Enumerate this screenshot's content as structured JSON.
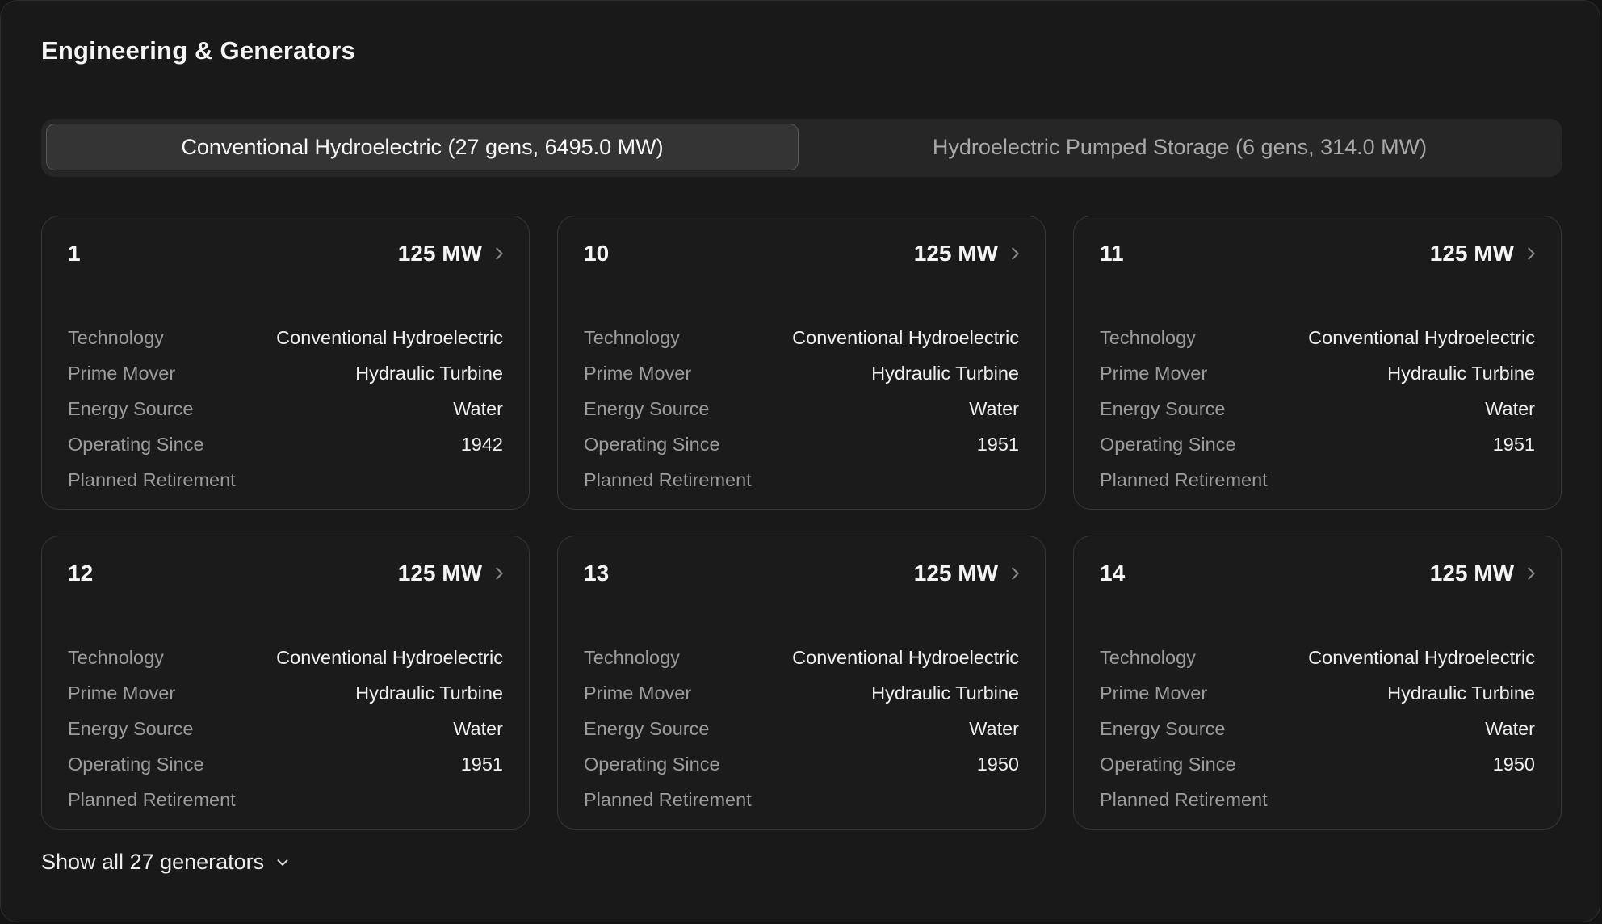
{
  "section": {
    "title": "Engineering & Generators"
  },
  "tabs": [
    {
      "label": "Conventional Hydroelectric (27 gens, 6495.0 MW)",
      "active": true
    },
    {
      "label": "Hydroelectric Pumped Storage (6 gens, 314.0 MW)",
      "active": false
    }
  ],
  "field_labels": {
    "technology": "Technology",
    "prime_mover": "Prime Mover",
    "energy_source": "Energy Source",
    "operating_since": "Operating Since",
    "planned_retirement": "Planned Retirement"
  },
  "generators": [
    {
      "id": "1",
      "capacity": "125 MW",
      "technology": "Conventional Hydroelectric",
      "prime_mover": "Hydraulic Turbine",
      "energy_source": "Water",
      "operating_since": "1942",
      "planned_retirement": ""
    },
    {
      "id": "10",
      "capacity": "125 MW",
      "technology": "Conventional Hydroelectric",
      "prime_mover": "Hydraulic Turbine",
      "energy_source": "Water",
      "operating_since": "1951",
      "planned_retirement": ""
    },
    {
      "id": "11",
      "capacity": "125 MW",
      "technology": "Conventional Hydroelectric",
      "prime_mover": "Hydraulic Turbine",
      "energy_source": "Water",
      "operating_since": "1951",
      "planned_retirement": ""
    },
    {
      "id": "12",
      "capacity": "125 MW",
      "technology": "Conventional Hydroelectric",
      "prime_mover": "Hydraulic Turbine",
      "energy_source": "Water",
      "operating_since": "1951",
      "planned_retirement": ""
    },
    {
      "id": "13",
      "capacity": "125 MW",
      "technology": "Conventional Hydroelectric",
      "prime_mover": "Hydraulic Turbine",
      "energy_source": "Water",
      "operating_since": "1950",
      "planned_retirement": ""
    },
    {
      "id": "14",
      "capacity": "125 MW",
      "technology": "Conventional Hydroelectric",
      "prime_mover": "Hydraulic Turbine",
      "energy_source": "Water",
      "operating_since": "1950",
      "planned_retirement": ""
    }
  ],
  "show_all": {
    "label": "Show all 27 generators"
  },
  "icons": {
    "card_arrow": "chevron-right-icon",
    "show_all": "chevron-down-icon"
  },
  "colors": {
    "background": "#191919",
    "card_border": "#363636",
    "label_text": "#9c9c9c",
    "value_text": "#f0f0f0"
  }
}
